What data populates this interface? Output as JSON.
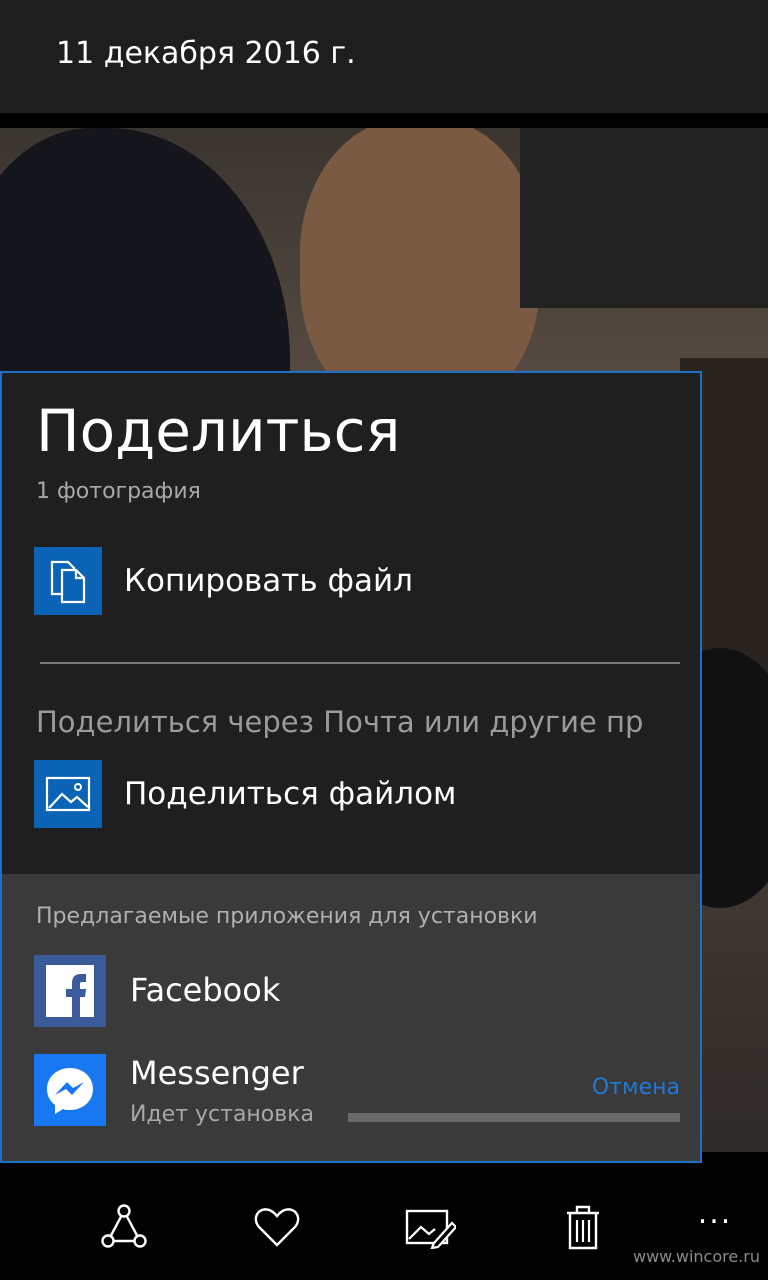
{
  "header": {
    "date": "11 декабря 2016 г."
  },
  "share": {
    "title": "Поделиться",
    "subtitle": "1 фотография",
    "copy_file": {
      "label": "Копировать файл",
      "icon": "copy-file-icon"
    },
    "via_text": "Поделиться через Почта или другие пр",
    "share_file": {
      "label": "Поделиться файлом",
      "icon": "image-icon"
    },
    "suggested": {
      "title": "Предлагаемые приложения для установки",
      "apps": [
        {
          "name": "Facebook",
          "icon": "facebook-icon",
          "color": "#3b5a9a"
        },
        {
          "name": "Messenger",
          "icon": "messenger-icon",
          "color": "#1877f2",
          "status": "Идет установка",
          "progress_fraction": 0.0,
          "cancel_label": "Отмена"
        }
      ]
    }
  },
  "appbar": {
    "buttons": [
      "share-icon",
      "favorite-icon",
      "edit-image-icon",
      "delete-icon"
    ],
    "more_label": "..."
  },
  "watermark": "www.wincore.ru",
  "colors": {
    "accent": "#1e6fc8",
    "tile": "#0b63b6",
    "panel": "#1f1f1f",
    "suggested_bg": "#3a3a3a",
    "link": "#1e7ad6"
  }
}
